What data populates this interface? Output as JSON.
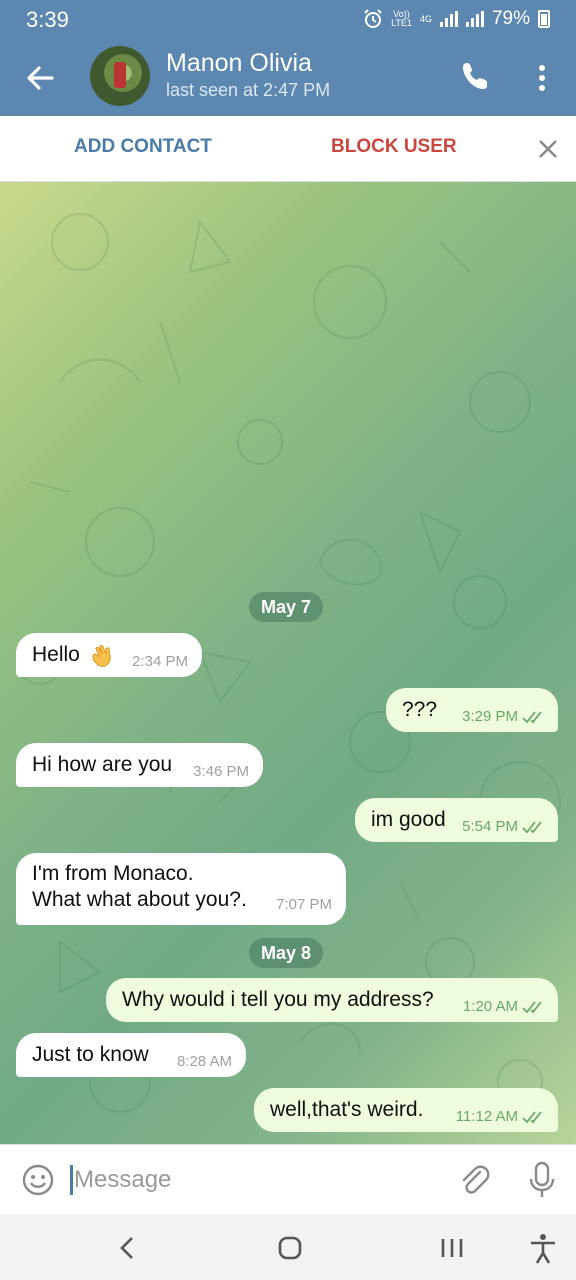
{
  "status_bar": {
    "time": "3:39",
    "network_top": "Vo))",
    "network_bottom": "LTE1",
    "data_type": "4G",
    "battery": "79%",
    "icons": [
      "alarm-icon",
      "signal-icon",
      "battery-icon"
    ]
  },
  "app_bar": {
    "contact_name": "Manon Olivia",
    "last_seen": "last seen at 2:47 PM",
    "icons": [
      "back-arrow-icon",
      "phone-icon",
      "more-vert-icon"
    ]
  },
  "action_bar": {
    "add_contact": "ADD CONTACT",
    "block_user": "BLOCK USER",
    "close_icon": "close-icon"
  },
  "colors": {
    "header": "#5b87b0",
    "add_contact": "#4a7aa8",
    "block_user": "#c9473d",
    "outgoing_bubble": "#eefbdc",
    "incoming_bubble": "#ffffff",
    "read_check": "#6aa86a"
  },
  "dates": [
    "May 7",
    "May 8"
  ],
  "messages": [
    {
      "direction": "in",
      "text": "Hello",
      "emoji": "waving-hand-icon",
      "time": "2:34 PM"
    },
    {
      "direction": "out",
      "text": "???",
      "time": "3:29 PM",
      "read": true
    },
    {
      "direction": "in",
      "text": "Hi how are you",
      "time": "3:46 PM"
    },
    {
      "direction": "out",
      "text": "im good",
      "time": "5:54 PM",
      "read": true
    },
    {
      "direction": "in",
      "lines": [
        "I'm from Monaco.",
        "What what about you?."
      ],
      "time": "7:07 PM"
    },
    {
      "direction": "out",
      "text": "Why would i tell you my address?",
      "time": "1:20 AM",
      "read": true
    },
    {
      "direction": "in",
      "text": "Just to know",
      "time": "8:28 AM"
    },
    {
      "direction": "out",
      "text": "well,that's weird.",
      "time": "11:12 AM",
      "read": true
    }
  ],
  "input_bar": {
    "placeholder": "Message",
    "icons": [
      "emoji-icon",
      "attach-icon",
      "mic-icon"
    ]
  },
  "nav_bar": {
    "icons": [
      "nav-back-icon",
      "nav-home-icon",
      "nav-recent-apps-icon",
      "accessibility-icon"
    ]
  }
}
